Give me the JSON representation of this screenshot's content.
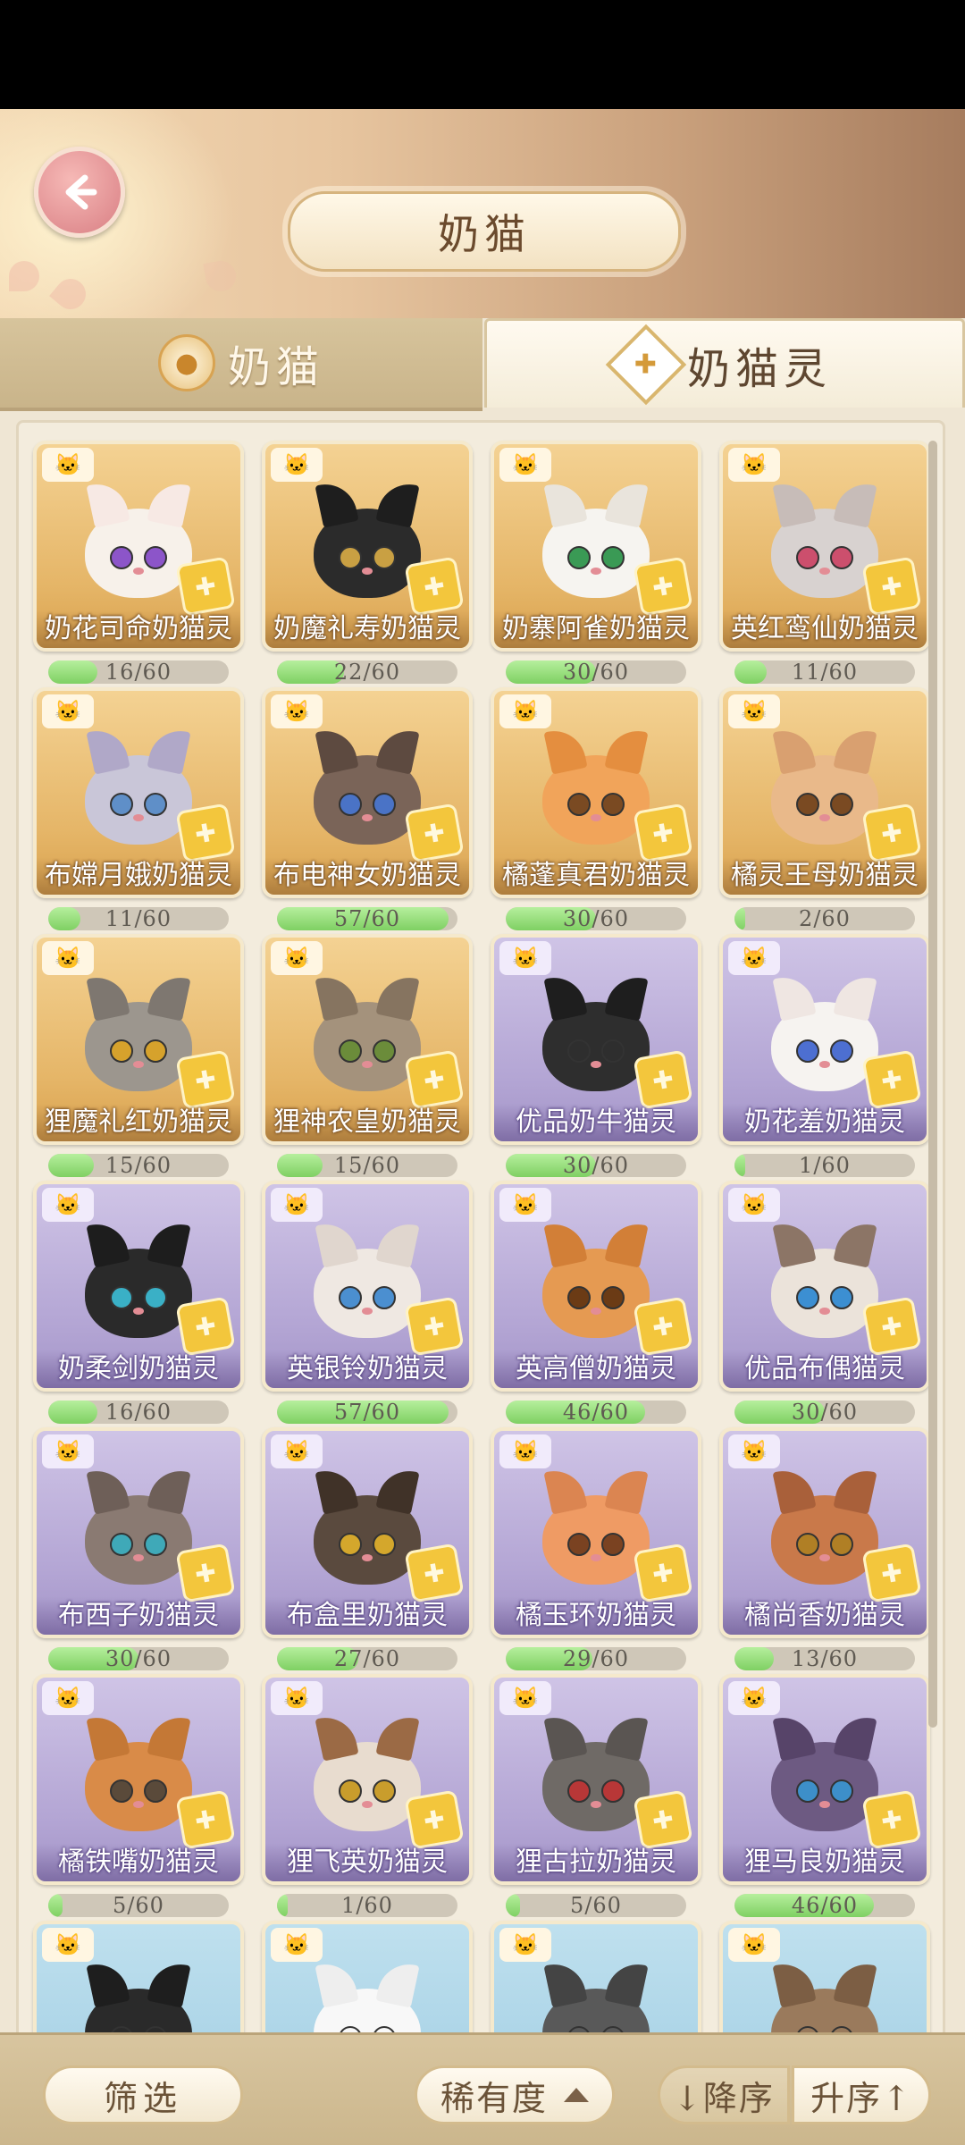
{
  "header": {
    "title": "奶猫"
  },
  "tabs": [
    {
      "label": "奶猫",
      "icon": "paw-icon",
      "active": false
    },
    {
      "label": "奶猫灵",
      "icon": "puzzle-icon",
      "active": true
    }
  ],
  "cards": [
    {
      "name": "奶花司命奶猫灵",
      "progress": "16/60",
      "fill": 0.27,
      "bg": "gold",
      "fur": "#f7f1ea",
      "eye": "#8c55c9",
      "ear": "#f7e9e4"
    },
    {
      "name": "奶魔礼寿奶猫灵",
      "progress": "22/60",
      "fill": 0.37,
      "bg": "gold",
      "fur": "#2b2b2b",
      "eye": "#c9a043",
      "ear": "#1e1e1e"
    },
    {
      "name": "奶寨阿雀奶猫灵",
      "progress": "30/60",
      "fill": 0.5,
      "bg": "gold",
      "fur": "#f6f4f0",
      "eye": "#3a9a55",
      "ear": "#e9e4dc"
    },
    {
      "name": "英红鸾仙奶猫灵",
      "progress": "11/60",
      "fill": 0.18,
      "bg": "gold",
      "fur": "#d8d2d0",
      "eye": "#cc4f6d",
      "ear": "#c7bcb8"
    },
    {
      "name": "布嫦月娥奶猫灵",
      "progress": "11/60",
      "fill": 0.18,
      "bg": "gold",
      "fur": "#c9c6d8",
      "eye": "#5f8fc8",
      "ear": "#b0a8c8"
    },
    {
      "name": "布电神女奶猫灵",
      "progress": "57/60",
      "fill": 0.95,
      "bg": "gold",
      "fur": "#7a6458",
      "eye": "#4a73c6",
      "ear": "#5d4a40"
    },
    {
      "name": "橘蓬真君奶猫灵",
      "progress": "30/60",
      "fill": 0.5,
      "bg": "gold",
      "fur": "#f1a45a",
      "eye": "#7a4a22",
      "ear": "#e48e3f"
    },
    {
      "name": "橘灵王母奶猫灵",
      "progress": "2/60",
      "fill": 0.03,
      "bg": "gold",
      "fur": "#e9b98a",
      "eye": "#7a4a22",
      "ear": "#d9a070"
    },
    {
      "name": "狸魔礼红奶猫灵",
      "progress": "15/60",
      "fill": 0.25,
      "bg": "gold",
      "fur": "#9c968e",
      "eye": "#d6a22c",
      "ear": "#7e7770"
    },
    {
      "name": "狸神农皇奶猫灵",
      "progress": "15/60",
      "fill": 0.25,
      "bg": "gold",
      "fur": "#a4927c",
      "eye": "#6b8c3a",
      "ear": "#867460"
    },
    {
      "name": "优品奶牛猫灵",
      "progress": "30/60",
      "fill": 0.5,
      "bg": "purple",
      "fur": "#2e2e2e",
      "eye": "#2e2e2e",
      "ear": "#1e1e1e"
    },
    {
      "name": "奶花羞奶猫灵",
      "progress": "1/60",
      "fill": 0.02,
      "bg": "purple",
      "fur": "#f6f3f0",
      "eye": "#4d6fd1",
      "ear": "#efe6e2"
    },
    {
      "name": "奶柔剑奶猫灵",
      "progress": "16/60",
      "fill": 0.27,
      "bg": "purple",
      "fur": "#2a2a2a",
      "eye": "#3ab0c6",
      "ear": "#1d1d1d"
    },
    {
      "name": "英银铃奶猫灵",
      "progress": "57/60",
      "fill": 0.95,
      "bg": "purple",
      "fur": "#efe8e2",
      "eye": "#4b8fd0",
      "ear": "#e0d6ce"
    },
    {
      "name": "英高僧奶猫灵",
      "progress": "46/60",
      "fill": 0.77,
      "bg": "purple",
      "fur": "#e59a52",
      "eye": "#6b3b15",
      "ear": "#d27f37"
    },
    {
      "name": "优品布偶猫灵",
      "progress": "30/60",
      "fill": 0.5,
      "bg": "purple",
      "fur": "#ebe3da",
      "eye": "#3c8fd2",
      "ear": "#8c7566"
    },
    {
      "name": "布西子奶猫灵",
      "progress": "30/60",
      "fill": 0.5,
      "bg": "purple",
      "fur": "#8a7a72",
      "eye": "#3fa9b8",
      "ear": "#6e5f58"
    },
    {
      "name": "布盒里奶猫灵",
      "progress": "27/60",
      "fill": 0.45,
      "bg": "purple",
      "fur": "#5a4a3e",
      "eye": "#d4a72c",
      "ear": "#403228"
    },
    {
      "name": "橘玉环奶猫灵",
      "progress": "29/60",
      "fill": 0.48,
      "bg": "purple",
      "fur": "#ef9b64",
      "eye": "#7a4221",
      "ear": "#db8551"
    },
    {
      "name": "橘尚香奶猫灵",
      "progress": "13/60",
      "fill": 0.22,
      "bg": "purple",
      "fur": "#c9794a",
      "eye": "#b07f25",
      "ear": "#a9603a"
    },
    {
      "name": "橘铁嘴奶猫灵",
      "progress": "5/60",
      "fill": 0.08,
      "bg": "purple",
      "fur": "#d98b48",
      "eye": "#5a4a3a",
      "ear": "#c47836"
    },
    {
      "name": "狸飞英奶猫灵",
      "progress": "1/60",
      "fill": 0.02,
      "bg": "purple",
      "fur": "#e8dccf",
      "eye": "#c99d2c",
      "ear": "#9b6a45"
    },
    {
      "name": "狸古拉奶猫灵",
      "progress": "5/60",
      "fill": 0.08,
      "bg": "purple",
      "fur": "#6f6a66",
      "eye": "#b83737",
      "ear": "#5a5552"
    },
    {
      "name": "狸马良奶猫灵",
      "progress": "46/60",
      "fill": 0.77,
      "bg": "purple",
      "fur": "#6d5a82",
      "eye": "#3d8fc9",
      "ear": "#574469"
    },
    {
      "name": "",
      "progress": "",
      "fill": 0,
      "bg": "blue",
      "fur": "#2a2a2a",
      "eye": "#2a2a2a",
      "ear": "#1e1e1e"
    },
    {
      "name": "",
      "progress": "",
      "fill": 0,
      "bg": "blue",
      "fur": "#f8f8f8",
      "eye": "#f8f8f8",
      "ear": "#eeeeee"
    },
    {
      "name": "",
      "progress": "",
      "fill": 0,
      "bg": "blue",
      "fur": "#595959",
      "eye": "#595959",
      "ear": "#444444"
    },
    {
      "name": "",
      "progress": "",
      "fill": 0,
      "bg": "blue",
      "fur": "#9a7a5c",
      "eye": "#9a7a5c",
      "ear": "#7c5e44"
    }
  ],
  "bottom": {
    "filter_label": "筛选",
    "rarity_label": "稀有度",
    "sort_desc_label": "↓降序",
    "sort_asc_label": "升序↑"
  }
}
